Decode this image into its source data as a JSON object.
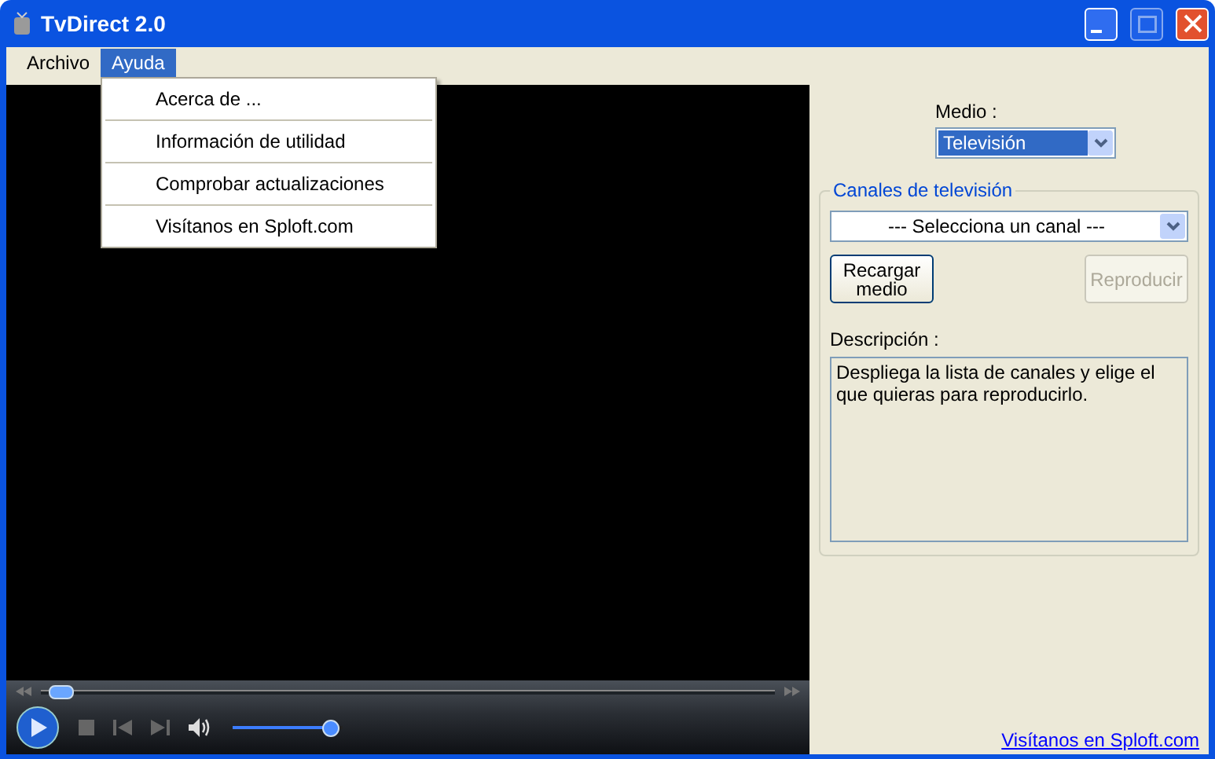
{
  "window": {
    "title": "TvDirect 2.0",
    "buttons": [
      {
        "kind": "minimize",
        "disabled": false
      },
      {
        "kind": "maximize",
        "disabled": true
      },
      {
        "kind": "close",
        "disabled": false
      }
    ]
  },
  "menu": [
    {
      "label": "Archivo",
      "selected": false
    },
    {
      "label": "Ayuda",
      "selected": true
    }
  ],
  "dropdown": [
    "Acerca de ...",
    "Información de utilidad",
    "Comprobar actualizaciones",
    "Visítanos en Sploft.com"
  ],
  "player": {
    "seek": {
      "level": 0.01
    },
    "volume": {
      "level": 0.95
    }
  },
  "panel": {
    "medio_label": "Medio :",
    "medio_value": "Televisión",
    "group_title": "Canales de televisión",
    "channel_value": "--- Selecciona un canal ---",
    "buttons": [
      {
        "label": "Recargar medio",
        "disabled": false
      },
      {
        "label": "Reproducir",
        "disabled": true
      }
    ],
    "description_label": "Descripción :",
    "description": "Despliega la lista de canales y elige el que quieras para reproducirlo."
  },
  "footer_link": "Visítanos en Sploft.com"
}
